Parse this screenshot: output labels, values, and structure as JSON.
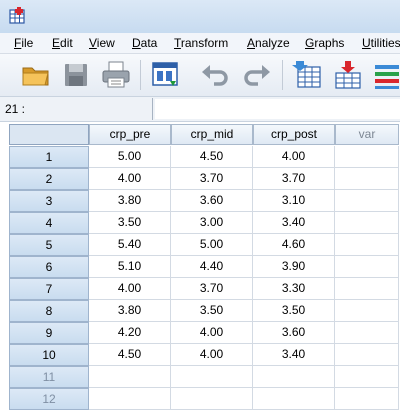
{
  "menu": [
    {
      "label": "File",
      "mnemonic": "F",
      "rest": "ile"
    },
    {
      "label": "Edit",
      "mnemonic": "E",
      "rest": "dit"
    },
    {
      "label": "View",
      "mnemonic": "V",
      "rest": "iew"
    },
    {
      "label": "Data",
      "mnemonic": "D",
      "rest": "ata"
    },
    {
      "label": "Transform",
      "mnemonic": "T",
      "rest": "ransform"
    },
    {
      "label": "Analyze",
      "mnemonic": "A",
      "rest": "nalyze"
    },
    {
      "label": "Graphs",
      "mnemonic": "G",
      "rest": "raphs"
    },
    {
      "label": "Utilities",
      "mnemonic": "U",
      "rest": "tilities"
    }
  ],
  "toolbar": {
    "icons": [
      "open-folder-icon",
      "save-icon",
      "print-icon",
      "dialog-recall-icon",
      "undo-icon",
      "redo-icon",
      "goto-case-icon",
      "goto-variable-icon",
      "variables-icon"
    ]
  },
  "cell_ref": {
    "label": "21 :",
    "value": ""
  },
  "grid": {
    "columns": [
      "crp_pre",
      "crp_mid",
      "crp_post",
      "var"
    ],
    "rows": [
      {
        "num": "1",
        "values": [
          "5.00",
          "4.50",
          "4.00",
          ""
        ]
      },
      {
        "num": "2",
        "values": [
          "4.00",
          "3.70",
          "3.70",
          ""
        ]
      },
      {
        "num": "3",
        "values": [
          "3.80",
          "3.60",
          "3.10",
          ""
        ]
      },
      {
        "num": "4",
        "values": [
          "3.50",
          "3.00",
          "3.40",
          ""
        ]
      },
      {
        "num": "5",
        "values": [
          "5.40",
          "5.00",
          "4.60",
          ""
        ]
      },
      {
        "num": "6",
        "values": [
          "5.10",
          "4.40",
          "3.90",
          ""
        ]
      },
      {
        "num": "7",
        "values": [
          "4.00",
          "3.70",
          "3.30",
          ""
        ]
      },
      {
        "num": "8",
        "values": [
          "3.80",
          "3.50",
          "3.50",
          ""
        ]
      },
      {
        "num": "9",
        "values": [
          "4.20",
          "4.00",
          "3.60",
          ""
        ]
      },
      {
        "num": "10",
        "values": [
          "4.50",
          "4.00",
          "3.40",
          ""
        ]
      },
      {
        "num": "11",
        "values": [
          "",
          "",
          "",
          ""
        ]
      },
      {
        "num": "12",
        "values": [
          "",
          "",
          "",
          ""
        ]
      }
    ]
  }
}
